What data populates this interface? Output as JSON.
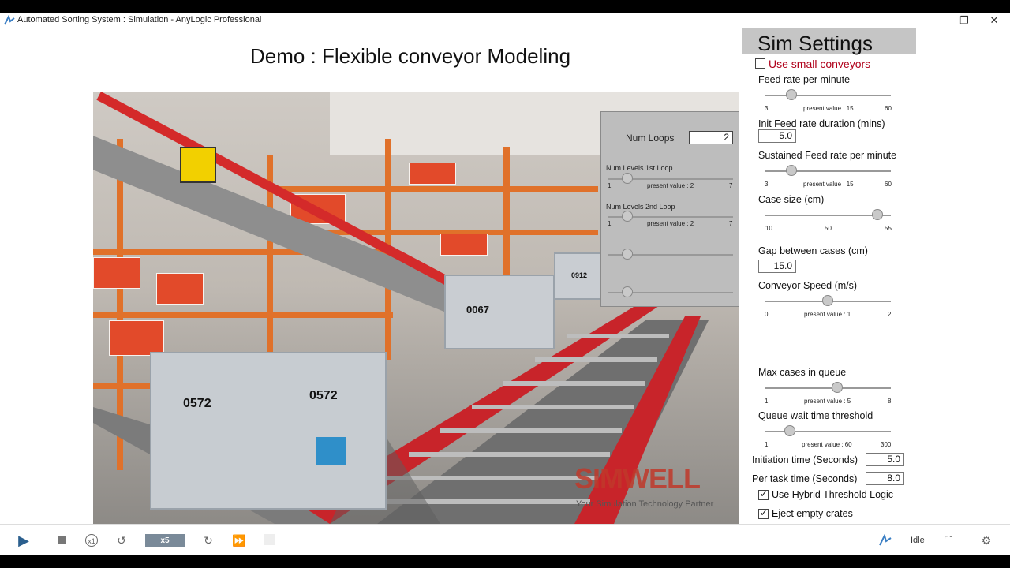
{
  "window": {
    "title": "Automated Sorting System : Simulation - AnyLogic Professional",
    "minimize_icon": "minimize-icon",
    "restore_icon": "restore-icon",
    "close_icon": "close-icon"
  },
  "demo_title": "Demo : Flexible conveyor Modeling",
  "scene": {
    "crate_labels": [
      "0572",
      "0572",
      "0067",
      "0912"
    ],
    "logo_text": "SIMWELL",
    "logo_tagline": "Your Simulation Technology Partner"
  },
  "overlay_panel": {
    "num_loops_label": "Num Loops",
    "num_loops_value": "2",
    "slider1": {
      "label": "Num Levels 1st Loop",
      "min": "1",
      "max": "7",
      "present": "present value : 2",
      "value": 2
    },
    "slider2": {
      "label": "Num Levels 2nd Loop",
      "min": "1",
      "max": "7",
      "present": "present value : 2",
      "value": 2
    }
  },
  "sim_settings": {
    "heading": "Sim Settings",
    "use_small_conveyors": {
      "label": "Use small conveyors",
      "checked": false,
      "color": "#b0001a"
    },
    "feed_rate": {
      "label": "Feed rate per minute",
      "min": "3",
      "max": "60",
      "present": "present value : 15"
    },
    "init_feed_duration": {
      "label": "Init Feed rate duration (mins)",
      "value": "5.0"
    },
    "sustained_feed": {
      "label": "Sustained Feed rate per minute",
      "min": "3",
      "max": "60",
      "present": "present value : 15"
    },
    "case_size": {
      "label": "Case size (cm)",
      "min": "10",
      "mid": "50",
      "max": "55"
    },
    "gap_between_cases": {
      "label": "Gap between cases (cm)",
      "value": "15.0"
    },
    "conveyor_speed": {
      "label": "Conveyor Speed (m/s)",
      "min": "0",
      "max": "2",
      "present": "present value : 1"
    },
    "max_cases_queue": {
      "label": "Max cases in queue",
      "min": "1",
      "max": "8",
      "present": "present value : 5"
    },
    "queue_wait": {
      "label": "Queue wait time threshold",
      "min": "1",
      "max": "300",
      "present": "present value : 60"
    },
    "initiation_time": {
      "label": "Initiation time (Seconds)",
      "value": "5.0"
    },
    "per_task_time": {
      "label": "Per task time (Seconds)",
      "value": "8.0"
    },
    "hybrid_logic": {
      "label": "Use Hybrid Threshold Logic",
      "checked": true
    },
    "eject_empty": {
      "label": "Eject empty crates",
      "checked": true
    }
  },
  "toolbar": {
    "speed": "x5",
    "x1": "x1",
    "status": "Idle"
  }
}
